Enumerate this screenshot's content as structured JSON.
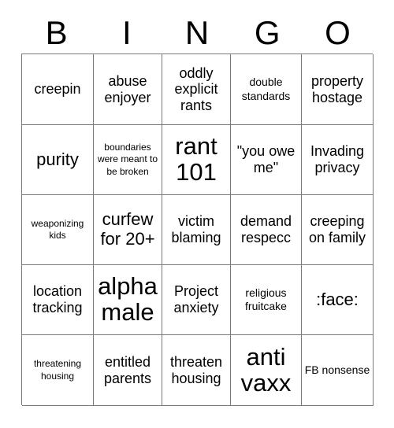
{
  "card": {
    "title": "BINGO",
    "header_letters": [
      "B",
      "I",
      "N",
      "G",
      "O"
    ],
    "grid_border_color": "#7a7a7a",
    "text_color": "#000000",
    "background_color": "#ffffff",
    "rows": [
      [
        {
          "text": "creepin",
          "size": "m"
        },
        {
          "text": "abuse enjoyer",
          "size": "m"
        },
        {
          "text": "oddly explicit rants",
          "size": "m"
        },
        {
          "text": "double standards",
          "size": "s"
        },
        {
          "text": "property hostage",
          "size": "m"
        }
      ],
      [
        {
          "text": "purity",
          "size": "l"
        },
        {
          "text": "boundaries were meant to be broken",
          "size": "xs"
        },
        {
          "text": "rant 101",
          "size": "xxl"
        },
        {
          "text": "\"you owe me\"",
          "size": "m"
        },
        {
          "text": "Invading privacy",
          "size": "m"
        }
      ],
      [
        {
          "text": "weaponizing kids",
          "size": "xs"
        },
        {
          "text": "curfew for 20+",
          "size": "l"
        },
        {
          "text": "victim blaming",
          "size": "m"
        },
        {
          "text": "demand respecc",
          "size": "m"
        },
        {
          "text": "creeping on family",
          "size": "m"
        }
      ],
      [
        {
          "text": "location tracking",
          "size": "m"
        },
        {
          "text": "alpha male",
          "size": "xxl"
        },
        {
          "text": "Project anxiety",
          "size": "m"
        },
        {
          "text": "religious fruitcake",
          "size": "s"
        },
        {
          "text": ":face:",
          "size": "l"
        }
      ],
      [
        {
          "text": "threatening housing",
          "size": "xs"
        },
        {
          "text": "entitled parents",
          "size": "m"
        },
        {
          "text": "threaten housing",
          "size": "m"
        },
        {
          "text": "anti vaxx",
          "size": "xxl"
        },
        {
          "text": "FB nonsense",
          "size": "s"
        }
      ]
    ]
  }
}
